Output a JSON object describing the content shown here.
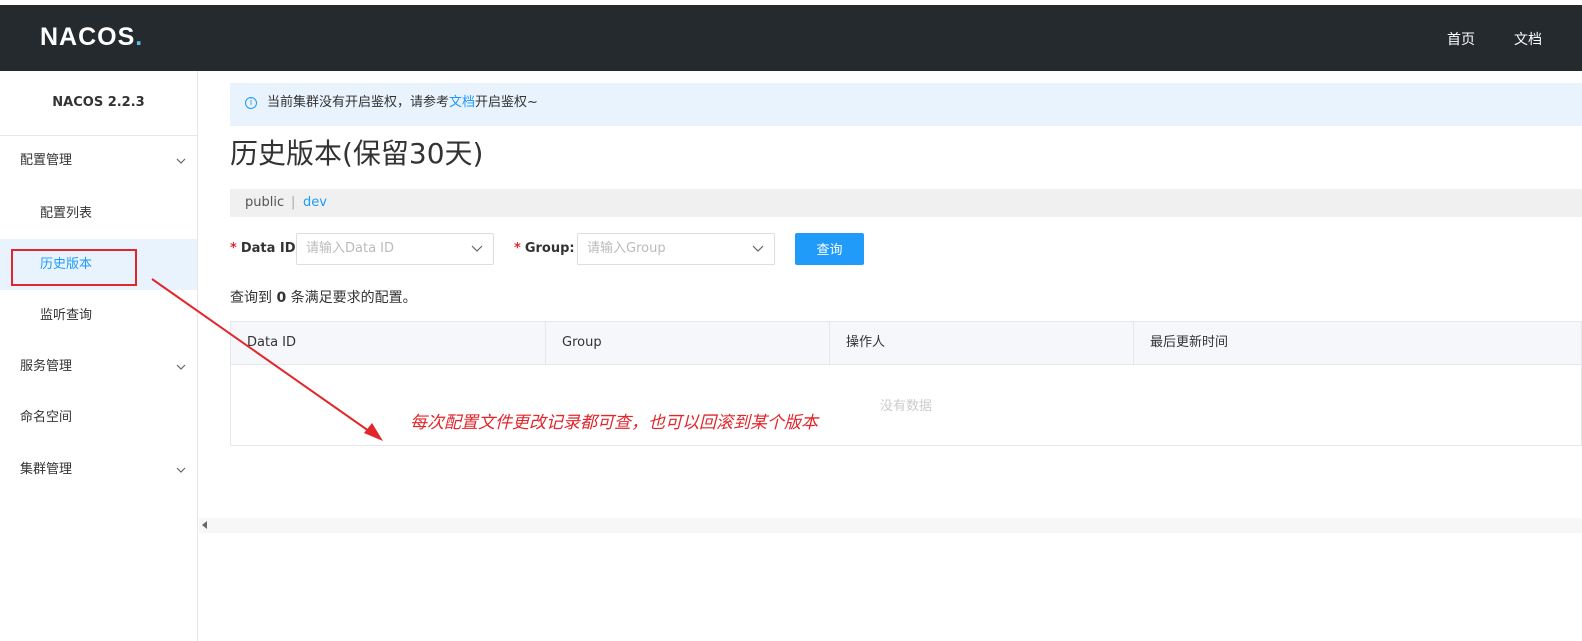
{
  "header": {
    "logo": "NACOS",
    "logo_dot": ".",
    "nav": [
      "首页",
      "文档"
    ]
  },
  "sidebar": {
    "version": "NACOS 2.2.3",
    "groups": [
      {
        "label": "配置管理",
        "items": [
          "配置列表",
          "历史版本",
          "监听查询"
        ]
      },
      {
        "label": "服务管理"
      },
      {
        "label": "命名空间"
      },
      {
        "label": "集群管理"
      }
    ],
    "active_item": "历史版本"
  },
  "alert": {
    "text_before": "当前集群没有开启鉴权，请参考",
    "link": "文档",
    "text_after": "开启鉴权~"
  },
  "page": {
    "title": "历史版本(保留30天)",
    "breadcrumb": [
      "public",
      "dev"
    ],
    "breadcrumb_sep": "|"
  },
  "form": {
    "data_id_label": "Data ID",
    "data_id_placeholder": "请输入Data ID",
    "group_label": "Group:",
    "group_placeholder": "请输入Group",
    "query_button": "查询",
    "required_mark": "*"
  },
  "result": {
    "prefix": "查询到",
    "count": "0",
    "suffix": "条满足要求的配置。"
  },
  "table": {
    "columns": [
      "Data ID",
      "Group",
      "操作人",
      "最后更新时间"
    ],
    "empty_text": "没有数据"
  },
  "annotation": {
    "text": "每次配置文件更改记录都可查，也可以回滚到某个版本",
    "color": "#e2262c"
  },
  "colors": {
    "header_bg": "#252a2f",
    "accent": "#209bfa",
    "annotation_red": "#e2262c"
  }
}
